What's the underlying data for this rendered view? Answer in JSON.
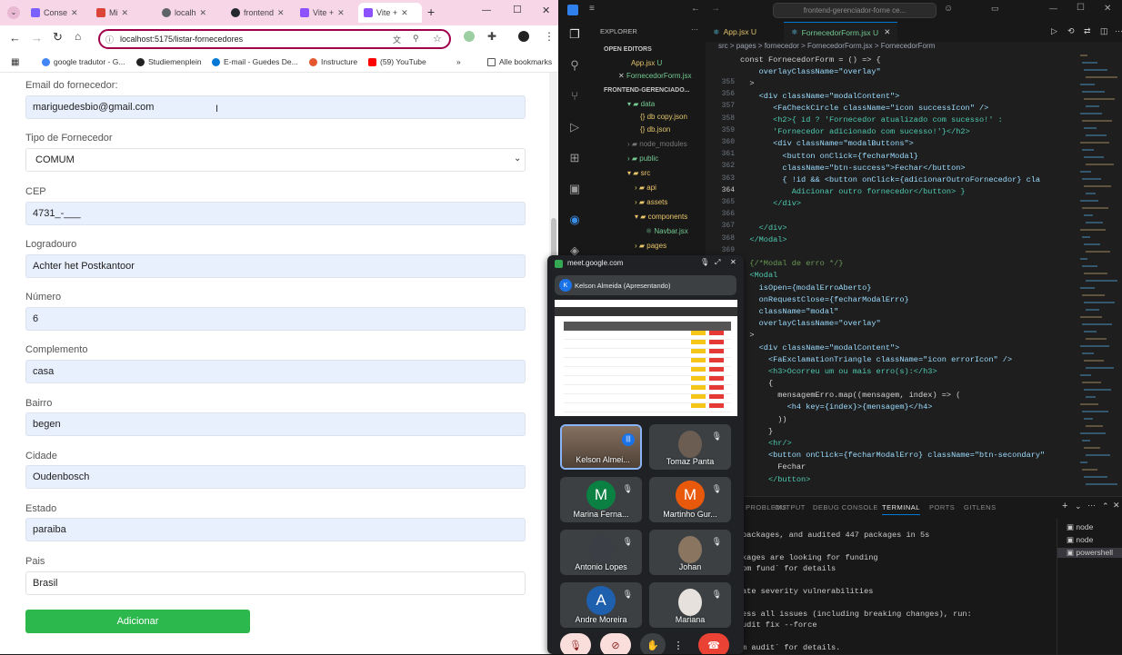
{
  "browser": {
    "tabs": [
      {
        "label": "Conse",
        "color": "#7b61ff"
      },
      {
        "label": "Mi",
        "color": "#db4437"
      },
      {
        "label": "localh",
        "color": "#5f6368"
      },
      {
        "label": "frontend",
        "color": "#24292f"
      },
      {
        "label": "Vite +",
        "color": "#8c52ff"
      },
      {
        "label": "Vite +",
        "color": "#8c52ff"
      }
    ],
    "new_tab_label": "+",
    "url": "localhost:5175/listar-fornecedores",
    "bookmarks": [
      {
        "label": "google tradutor - G...",
        "color": "#4285f4"
      },
      {
        "label": "Studiemenplein",
        "color": "#222222"
      },
      {
        "label": "E-mail - Guedes De...",
        "color": "#0078d4"
      },
      {
        "label": "Instructure",
        "color": "#e4572e"
      },
      {
        "label": "(59) YouTube",
        "color": "#ff0000"
      }
    ],
    "all_bookmarks_label": "Alle bookmarks",
    "chevron_label": "»"
  },
  "form": {
    "email_label": "Email do fornecedor:",
    "email_value": "mariguedesbio@gmail.com",
    "tipo_label": "Tipo de Fornecedor",
    "tipo_value": "COMUM",
    "cep_label": "CEP",
    "cep_value": "4731_-___",
    "logradouro_label": "Logradouro",
    "logradouro_value": "Achter het Postkantoor",
    "numero_label": "Número",
    "numero_value": "6",
    "complemento_label": "Complemento",
    "complemento_value": "casa",
    "bairro_label": "Bairro",
    "bairro_value": "begen",
    "cidade_label": "Cidade",
    "cidade_value": "Oudenbosch",
    "estado_label": "Estado",
    "estado_value": "paraiba",
    "pais_label": "Pais",
    "pais_value": "Brasil",
    "submit_label": "Adicionar"
  },
  "vscode": {
    "search": "frontend-gerenciador-forne ce...",
    "explorer_title": "EXPLORER",
    "open_editors": "OPEN EDITORS",
    "open_files": [
      "App.jsx",
      "FornecedorForm.jsx"
    ],
    "project": "FRONTEND-GERENCIADO...",
    "tree": [
      {
        "label": "data",
        "badge": "U"
      },
      {
        "label": "db copy.json",
        "badge": "U"
      },
      {
        "label": "db.json",
        "badge": "U"
      },
      {
        "label": "node_modules",
        "badge": ""
      },
      {
        "label": "public",
        "badge": "U"
      },
      {
        "label": "src",
        "badge": ""
      },
      {
        "label": "api",
        "badge": ""
      },
      {
        "label": "assets",
        "badge": ""
      },
      {
        "label": "components",
        "badge": ""
      },
      {
        "label": "Navbar.jsx",
        "badge": "U"
      },
      {
        "label": "pages",
        "badge": ""
      }
    ],
    "editor_tabs": [
      "App.jsx U",
      "FornecedorForm.jsx U"
    ],
    "breadcrumb": "src > pages > fornecedor > FornecedorForm.jsx > FornecedorForm",
    "line_numbers": [
      "355",
      "356",
      "357",
      "358",
      "359",
      "360",
      "361",
      "362",
      "363",
      "364",
      "365",
      "366",
      "367",
      "368",
      "369"
    ],
    "code_lines": [
      "const FornecedorForm = () => {",
      "    overlayClassName=\"overlay\"",
      "  >",
      "    <div className=\"modalContent\">",
      "       <FaCheckCircle className=\"icon successIcon\" />",
      "       <h2>{ id ? 'Fornecedor atualizado com sucesso!' :",
      "       'Fornecedor adicionado com sucesso!'}</h2>",
      "       <div className=\"modalButtons\">",
      "         <button onClick={fecharModal}",
      "         className=\"btn-success\">Fechar</button>",
      "         { !id && <button onClick={adicionarOutroFornecedor} cla",
      "           Adicionar outro fornecedor</button> }",
      "       </div>",
      "",
      "    </div>",
      "  </Modal>",
      "",
      "  {/*Modal de erro */}",
      "  <Modal",
      "    isOpen={modalErroAberto}",
      "    onRequestClose={fecharModalErro}",
      "    className=\"modal\"",
      "    overlayClassName=\"overlay\"",
      "  >",
      "    <div className=\"modalContent\">",
      "      <FaExclamationTriangle className=\"icon errorIcon\" />",
      "      <h3>Ocorreu um ou mais erro(s):</h3>",
      "      {",
      "        mensagemErro.map((mensagem, index) => (",
      "          <h4 key={index}>{mensagem}</h4>",
      "        ))",
      "      }",
      "      <hr/>",
      "      <button onClick={fecharModalErro} className=\"btn-secondary\"",
      "        Fechar",
      "      </button>"
    ],
    "panel_tabs": [
      "PROBLEMS",
      "OUTPUT",
      "DEBUG CONSOLE",
      "TERMINAL",
      "PORTS",
      "GITLENS"
    ],
    "terminal_lines": [
      "packages, and audited 447 packages in 5s",
      "",
      "kages are looking for funding",
      "pm fund` for details",
      "",
      "ate severity vulnerabilities",
      "",
      "ess all issues (including breaking changes), run:",
      "udit fix --force",
      "",
      "m audit` for details."
    ],
    "terminals": [
      "node",
      "node",
      "powershell"
    ]
  },
  "meet": {
    "host": "meet.google.com",
    "presenter": "Kelson Almeida (Apresentando)",
    "presenter_initial": "K",
    "participants": [
      {
        "name": "Kelson Almei...",
        "initial": "",
        "color": "#6b5a4e"
      },
      {
        "name": "Tomaz Panta",
        "initial": "",
        "color": "#5a5550"
      },
      {
        "name": "Marina Ferna...",
        "initial": "M",
        "color": "#0b8043"
      },
      {
        "name": "Martinho Gur...",
        "initial": "M",
        "color": "#e8590c"
      },
      {
        "name": "Antonio Lopes",
        "initial": "",
        "color": "#4b4f56"
      },
      {
        "name": "Johan",
        "initial": "",
        "color": "#8a7560"
      },
      {
        "name": "Andre Moreira",
        "initial": "A",
        "color": "#1e5fae"
      },
      {
        "name": "Mariana",
        "initial": "",
        "color": "#b3a59a"
      }
    ]
  }
}
